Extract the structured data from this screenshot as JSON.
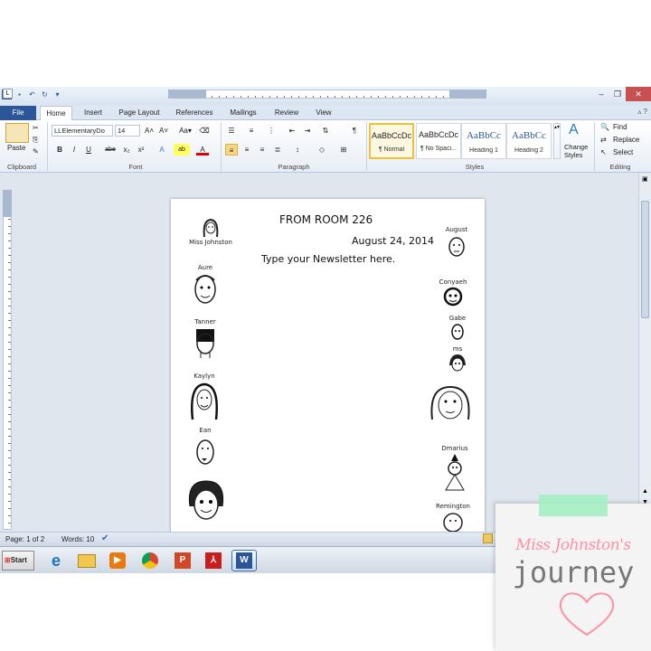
{
  "window": {
    "title": "newsletter1 2014.docx  -  Microsoft Word",
    "quick_access": [
      "W",
      "save",
      "undo",
      "redo",
      "customize"
    ],
    "controls": [
      "minimize",
      "restore",
      "close"
    ]
  },
  "tabs": [
    "File",
    "Home",
    "Insert",
    "Page Layout",
    "References",
    "Mailings",
    "Review",
    "View"
  ],
  "ribbon": {
    "clipboard": {
      "paste_label": "Paste",
      "group_label": "Clipboard"
    },
    "font": {
      "font_name": "LLElementaryDo",
      "font_size": "14",
      "group_label": "Font",
      "buttons": [
        "B",
        "I",
        "U",
        "abe",
        "x₂",
        "x²",
        "A",
        "ab",
        "A"
      ]
    },
    "paragraph": {
      "group_label": "Paragraph"
    },
    "styles": {
      "group_label": "Styles",
      "items": [
        {
          "sample": "AaBbCcDc",
          "name": "¶ Normal"
        },
        {
          "sample": "AaBbCcDc",
          "name": "¶ No Spaci..."
        },
        {
          "sample": "AaBbCc",
          "name": "Heading 1"
        },
        {
          "sample": "AaBbCc",
          "name": "Heading 2"
        }
      ],
      "change_styles_line1": "Change",
      "change_styles_line2": "Styles"
    },
    "editing": {
      "find": "Find",
      "replace": "Replace",
      "select": "Select",
      "group_label": "Editing"
    }
  },
  "document": {
    "heading": "FROM ROOM 226",
    "date": "August 24, 2014",
    "body": "Type your Newsletter here.",
    "left_column": [
      "Miss Johnston",
      "Aure",
      "Tanner",
      "Kaylyn",
      "Ean",
      ""
    ],
    "right_column": [
      "August",
      "Conyaeh",
      "Gabe",
      "ms",
      "",
      "Dmarius",
      "Remington"
    ]
  },
  "statusbar": {
    "page": "Page: 1 of 2",
    "words": "Words: 10"
  },
  "taskbar": {
    "start_label": "Start",
    "apps": [
      "internet-explorer",
      "file-explorer",
      "media-player",
      "chrome",
      "powerpoint",
      "acrobat",
      "word"
    ]
  },
  "branding": {
    "line1": "Miss Johnston's",
    "line2": "journey",
    "colors": {
      "pink": "#ff8fa3",
      "tape": "#a4f0c4",
      "gray": "#777777"
    }
  },
  "colors": {
    "file_tab": "#2b579a",
    "ribbon_bg": "#e8eef6"
  }
}
